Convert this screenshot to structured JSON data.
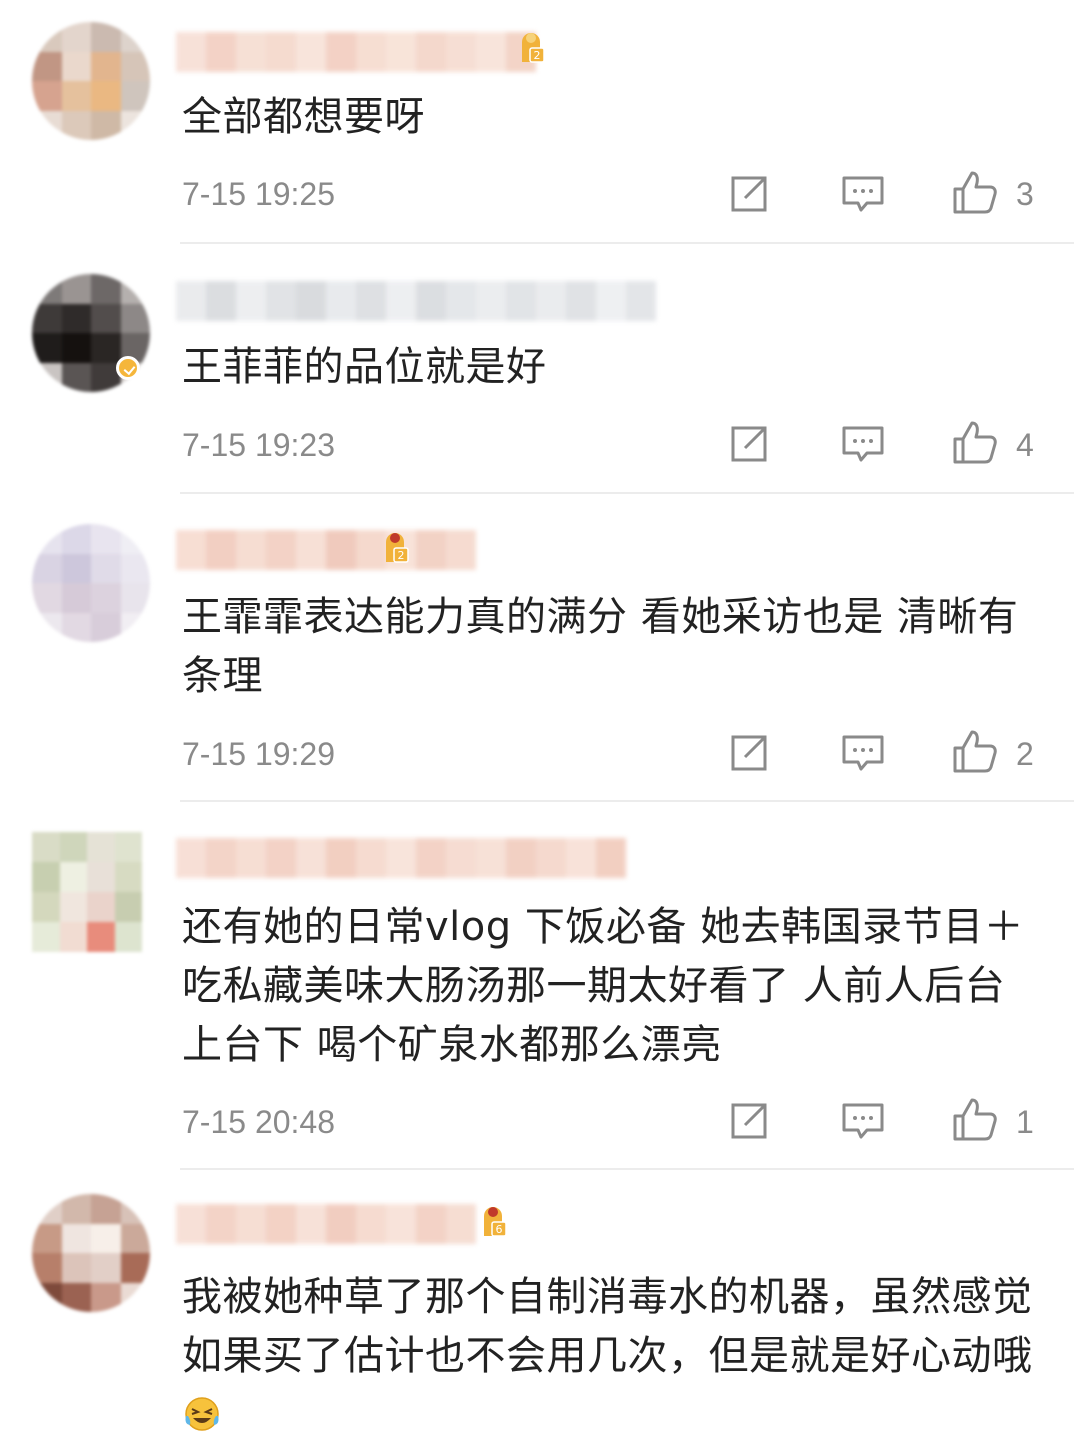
{
  "comments": [
    {
      "text": "全部都想要呀",
      "time": "7-15 19:25",
      "likes": "3",
      "level": "2",
      "avatar_colors": [
        "#d9c9bd",
        "#e3d5cc",
        "#cbbab0",
        "#ddd3cc",
        "#c19684",
        "#ead8cc",
        "#e2b58e",
        "#d6c5b8",
        "#d6a38f",
        "#e5c19d",
        "#eab882",
        "#cfc5bd",
        "#e8dcd4",
        "#dcc9ba",
        "#cfb9a6",
        "#ece4de"
      ],
      "name_colors": [
        "#f5d7cc",
        "#f0c4b4",
        "#f3d6c8",
        "#f2cfc0",
        "#f6dcd0",
        "#efc2b2",
        "#f4d3c4",
        "#f6dbcd",
        "#f1cbbb",
        "#f4d4c6",
        "#f6dcd0",
        "#efc6b5"
      ]
    },
    {
      "text": "王菲菲的品位就是好",
      "time": "7-15 19:23",
      "likes": "4",
      "level": "",
      "verified": true,
      "avatar_colors": [
        "#7e7a79",
        "#9a9492",
        "#6d6867",
        "#b5b0ae",
        "#3e3a39",
        "#2f2b2a",
        "#524d4c",
        "#8d8887",
        "#1f1c1b",
        "#15110f",
        "#2a2624",
        "#6a6564",
        "#c9c4c2",
        "#5a5554",
        "#403b3a",
        "#d6d1cf"
      ],
      "name_colors": [
        "#e3e5e8",
        "#cfd2d6",
        "#e7e9ec",
        "#d7dade",
        "#cdd0d4",
        "#e1e4e8",
        "#d3d6da",
        "#e8eaed",
        "#d0d3d7",
        "#dcdfe3",
        "#e5e7ea",
        "#d8dbdf",
        "#e4e6e9",
        "#d6d9dd",
        "#e9ebee",
        "#dadde1"
      ]
    },
    {
      "text": "王霏霏表达能力真的满分 看她采访也是 清晰有条理",
      "time": "7-15 19:29",
      "likes": "2",
      "level": "2",
      "avatar_colors": [
        "#e6e3ee",
        "#dcd8e8",
        "#e8e4ef",
        "#efeef4",
        "#d9d3e3",
        "#cdc7dc",
        "#e0dbe8",
        "#eae7f0",
        "#e1d8e2",
        "#d6cad8",
        "#dcd2de",
        "#e8e4ec",
        "#ece8ee",
        "#e2d9e3",
        "#d8cdda",
        "#f1eef3"
      ],
      "name_colors": [
        "#f5d3c5",
        "#eebfae",
        "#f3d2c3",
        "#efc4b3",
        "#f5d6c9",
        "#ebb9a7",
        "#f2cdbd",
        "#f6dacd",
        "#eec3b2",
        "#f3d0c1"
      ]
    },
    {
      "text": "还有她的日常vlog 下饭必备 她去韩国录节目＋吃私藏美味大肠汤那一期太好看了 人前人后台上台下 喝个矿泉水都那么漂亮",
      "time": "7-15 20:48",
      "likes": "1",
      "level": "",
      "avatar_colors": [
        "#d9dcc6",
        "#cfd6bb",
        "#e5e2d6",
        "#dfe3cf",
        "#c7cfb0",
        "#eef0e2",
        "#e8e0d8",
        "#d7dbc2",
        "#d4d8bd",
        "#f0e6de",
        "#ead3cb",
        "#c7cdb0",
        "#e6ebd9",
        "#f1dcd2",
        "#e88c7c",
        "#dde4cf"
      ],
      "name_colors": [
        "#f5d5c9",
        "#f0c6b6",
        "#f4d3c5",
        "#efc3b3",
        "#f5d7cb",
        "#eebfad",
        "#f3d0c1",
        "#f6dbcf",
        "#efc4b4",
        "#f3d1c3",
        "#f5d7ca",
        "#eec1b0",
        "#f2cdbe",
        "#f6d9cd",
        "#eebfad"
      ]
    },
    {
      "text": "我被她种草了那个自制消毒水的机器，虽然感觉如果买了估计也不会用几次，但是就是好心动哦",
      "time": "",
      "likes": "",
      "level": "6",
      "avatar_colors": [
        "#e0cfc7",
        "#d2b8ab",
        "#c6a294",
        "#d8c2b8",
        "#c79a86",
        "#efe5e0",
        "#f7efe9",
        "#cba99a",
        "#b77f6a",
        "#dcc4ba",
        "#e2cfc7",
        "#a86b57",
        "#7e4a3b",
        "#9b6252",
        "#c9998a",
        "#eadbd4"
      ],
      "name_colors": [
        "#f5d6ca",
        "#f0c5b5",
        "#f3d3c5",
        "#efc3b2",
        "#f5d8cc",
        "#edbdac",
        "#f3d0c1",
        "#f6dace",
        "#efc4b3",
        "#f3d2c4"
      ]
    }
  ],
  "icons": {
    "share": "share-icon",
    "reply": "comment-icon",
    "like": "thumbs-up-icon",
    "level": "user-level-badge-icon",
    "verified": "verified-badge-icon",
    "emoji": "laughing-tears-emoji-icon"
  },
  "colors": {
    "text": "#222222",
    "meta": "#8a8a8a",
    "divider": "#ececec",
    "level_gold": "#f1b23a"
  }
}
